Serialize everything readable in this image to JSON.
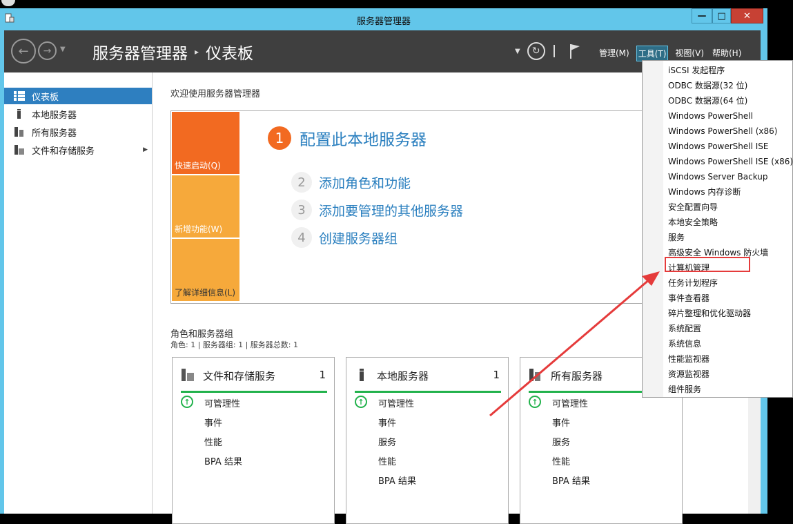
{
  "window": {
    "title": "服务器管理器",
    "controls": {
      "min": "—",
      "max": "□",
      "close": "✕"
    }
  },
  "header": {
    "breadcrumb": [
      "服务器管理器",
      "仪表板"
    ],
    "breadcrumb_sep": "▸",
    "menu": [
      "管理(M)",
      "工具(T)",
      "视图(V)",
      "帮助(H)"
    ],
    "active_menu": "工具(T)"
  },
  "sidebar": {
    "items": [
      {
        "label": "仪表板",
        "icon": "dashboard-icon",
        "selected": true
      },
      {
        "label": "本地服务器",
        "icon": "server-icon"
      },
      {
        "label": "所有服务器",
        "icon": "servers-icon"
      },
      {
        "label": "文件和存储服务",
        "icon": "storage-icon",
        "has_submenu": true
      }
    ]
  },
  "main": {
    "welcome": "欢迎使用服务器管理器",
    "tiles": [
      "快速启动(Q)",
      "新增功能(W)",
      "了解详细信息(L)"
    ],
    "steps": [
      {
        "num": "1",
        "label": "配置此本地服务器"
      },
      {
        "num": "2",
        "label": "添加角色和功能"
      },
      {
        "num": "3",
        "label": "添加要管理的其他服务器"
      },
      {
        "num": "4",
        "label": "创建服务器组"
      }
    ],
    "roles_title": "角色和服务器组",
    "roles_sub": "角色: 1 | 服务器组: 1 | 服务器总数: 1",
    "cards": [
      {
        "name": "文件和存储服务",
        "count": "1",
        "rows": [
          "可管理性",
          "事件",
          "性能",
          "BPA 结果"
        ]
      },
      {
        "name": "本地服务器",
        "count": "1",
        "rows": [
          "可管理性",
          "事件",
          "服务",
          "性能",
          "BPA 结果"
        ]
      },
      {
        "name": "所有服务器",
        "count": "",
        "rows": [
          "可管理性",
          "事件",
          "服务",
          "性能",
          "BPA 结果"
        ]
      }
    ]
  },
  "tools_menu": {
    "items": [
      "iSCSI 发起程序",
      "ODBC 数据源(32 位)",
      "ODBC 数据源(64 位)",
      "Windows PowerShell",
      "Windows PowerShell (x86)",
      "Windows PowerShell ISE",
      "Windows PowerShell ISE (x86)",
      "Windows Server Backup",
      "Windows 内存诊断",
      "安全配置向导",
      "本地安全策略",
      "服务",
      "高级安全 Windows 防火墙",
      "计算机管理",
      "任务计划程序",
      "事件查看器",
      "碎片整理和优化驱动器",
      "系统配置",
      "系统信息",
      "性能监视器",
      "资源监视器",
      "组件服务"
    ],
    "highlighted": "计算机管理"
  },
  "colors": {
    "titlebar": "#62c6ea",
    "header_bg": "#3f3f3f",
    "selected": "#2e7fc0",
    "quickstart": "#f26a21",
    "tile": "#f6a93b",
    "link": "#2a7fbf",
    "ok_green": "#22b24c",
    "annotation_red": "#e53b3b"
  }
}
